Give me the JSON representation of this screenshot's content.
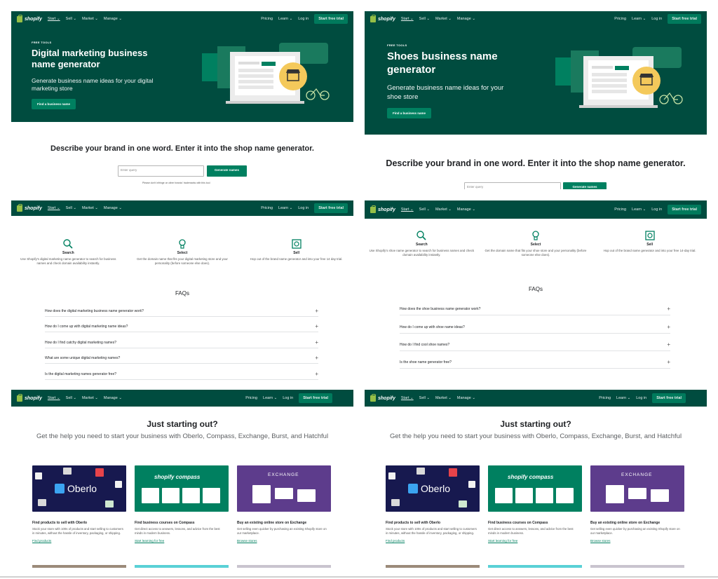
{
  "nav": {
    "brand": "shopify",
    "items": [
      "Start ⌄",
      "Sell ⌄",
      "Market ⌄",
      "Manage ⌄"
    ],
    "pricing": "Pricing",
    "learn": "Learn ⌄",
    "login": "Log in",
    "trial": "Start free trial"
  },
  "hero_a": {
    "tag": "FREE TOOLS",
    "title": "Digital marketing business name generator",
    "subtitle": "Generate business name ideas for your digital marketing store",
    "cta": "Find a business name"
  },
  "hero_b": {
    "tag": "FREE TOOLS",
    "title": "Shoes business name generator",
    "subtitle": "Generate business name ideas for your shoe store",
    "cta": "Find a business name"
  },
  "describe": "Describe your brand in one word. Enter it into the shop name generator.",
  "query": {
    "placeholder": "Enter query",
    "button": "Generate names",
    "note": "Please don't infringe on other brands' trademarks with this tool"
  },
  "steps_a": [
    {
      "title": "Search",
      "desc": "Use Shopify's digital marketing name generator to search for business names and check domain availability instantly."
    },
    {
      "title": "Select",
      "desc": "Get the domain name that fits your digital marketing store and your personality (before someone else does)."
    },
    {
      "title": "Sell",
      "desc": "Hop out of the brand name generator and into your free 14 day trial."
    }
  ],
  "steps_b": [
    {
      "title": "Search",
      "desc": "Use Shopify's shoe name generator to search for business names and check domain availability instantly."
    },
    {
      "title": "Select",
      "desc": "Get the domain name that fits your shoe store and your personality (before someone else does)."
    },
    {
      "title": "Sell",
      "desc": "Hop out of the brand name generator and into your free 14-day trial."
    }
  ],
  "faq_title": "FAQs",
  "faqs_a": [
    "How does the digital marketing business name generator work?",
    "How do I come up with digital marketing name ideas?",
    "How do I find catchy digital marketing names?",
    "What are some unique digital marketing names?",
    "Is the digital marketing names generator free?"
  ],
  "faqs_b": [
    "How does the shoe business name generator work?",
    "How do I come up with shoe name ideas?",
    "How do I find cool shoe names?",
    "Is the shoe name generator free?"
  ],
  "starting": {
    "title": "Just starting out?",
    "subtitle": "Get the help you need to start your business with Oberlo, Compass, Exchange, Burst, and Hatchful"
  },
  "cards": [
    {
      "brand": "Oberlo",
      "title": "Find products to sell with Oberlo",
      "desc": "Stock your store with 100s of products and start selling to customers in minutes, without the hassle of inventory, packaging, or shipping.",
      "link": "Find products"
    },
    {
      "brand": "shopify compass",
      "title": "Find business courses on Compass",
      "desc": "Get direct access to answers, lessons, and advice from the best minds in modern business.",
      "link": "Start learning for free"
    },
    {
      "brand": "EXCHANGE",
      "title": "Buy an existing online store on Exchange",
      "desc": "Get selling even quicker by purchasing an existing Shopify store on our marketplace.",
      "link": "Browse stores"
    }
  ],
  "colors": {
    "brand_dark": "#004c3f",
    "accent": "#008060",
    "shopify_green": "#95bf47",
    "oberlo_bg": "#17194f",
    "compass_bg": "#008060",
    "exchange_bg": "#5d3c8c"
  }
}
